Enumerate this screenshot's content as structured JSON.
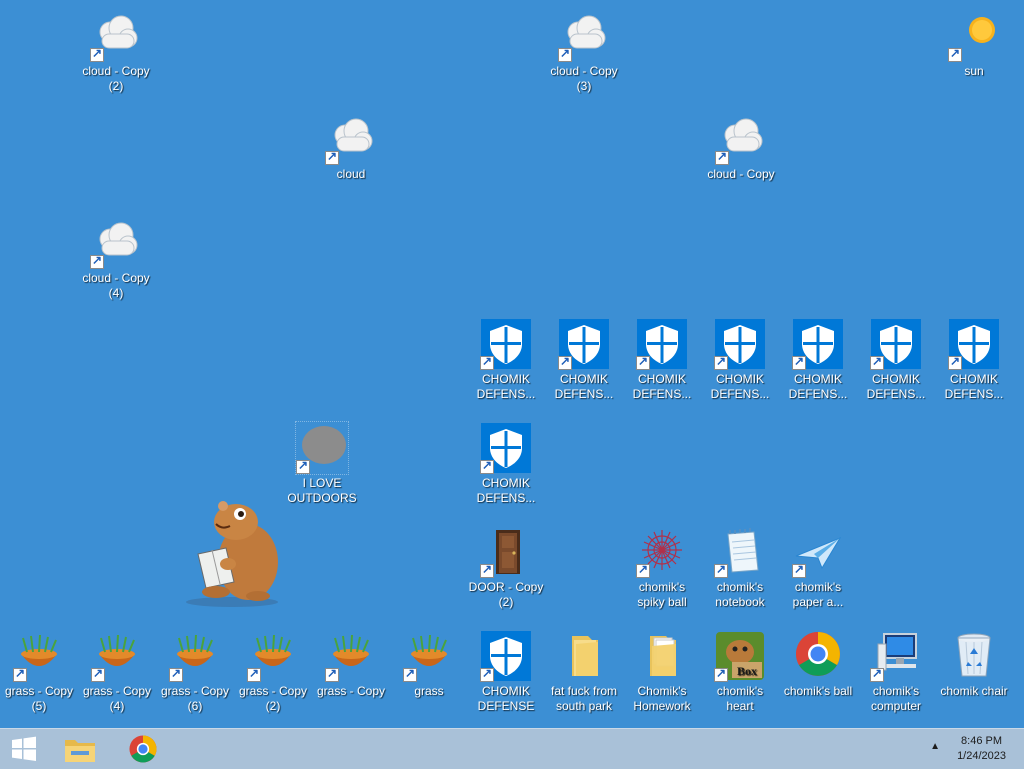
{
  "desktop": {
    "background": "#3c8fd4",
    "icons": [
      {
        "label": "cloud - Copy (2)",
        "type": "cloud"
      },
      {
        "label": "cloud - Copy (3)",
        "type": "cloud"
      },
      {
        "label": "sun",
        "type": "sun"
      },
      {
        "label": "cloud",
        "type": "cloud"
      },
      {
        "label": "cloud - Copy",
        "type": "cloud"
      },
      {
        "label": "cloud - Copy (4)",
        "type": "cloud"
      },
      {
        "label": "CHOMIK DEFENS...",
        "type": "shield"
      },
      {
        "label": "CHOMIK DEFENS...",
        "type": "shield"
      },
      {
        "label": "CHOMIK DEFENS...",
        "type": "shield"
      },
      {
        "label": "CHOMIK DEFENS...",
        "type": "shield"
      },
      {
        "label": "CHOMIK DEFENS...",
        "type": "shield"
      },
      {
        "label": "CHOMIK DEFENS...",
        "type": "shield"
      },
      {
        "label": "CHOMIK DEFENS...",
        "type": "shield"
      },
      {
        "label": "I LOVE OUTDOORS",
        "type": "blob"
      },
      {
        "label": "CHOMIK DEFENS...",
        "type": "shield"
      },
      {
        "label": "DOOR - Copy (2)",
        "type": "door"
      },
      {
        "label": "chomik's spiky ball",
        "type": "spiky"
      },
      {
        "label": "chomik's notebook",
        "type": "notebook"
      },
      {
        "label": "chomik's paper a...",
        "type": "plane"
      },
      {
        "label": "grass - Copy (5)",
        "type": "grass"
      },
      {
        "label": "grass - Copy (4)",
        "type": "grass"
      },
      {
        "label": "grass - Copy (6)",
        "type": "grass"
      },
      {
        "label": "grass - Copy (2)",
        "type": "grass"
      },
      {
        "label": "grass - Copy",
        "type": "grass"
      },
      {
        "label": "grass",
        "type": "grass"
      },
      {
        "label": "CHOMIK DEFENSE",
        "type": "shield"
      },
      {
        "label": "fat fuck from south park",
        "type": "folder"
      },
      {
        "label": "Chomik's Homework",
        "type": "folder-docs"
      },
      {
        "label": "chomik's heart",
        "type": "hamsterbox"
      },
      {
        "label": "chomik's ball",
        "type": "chrome"
      },
      {
        "label": "chomik's computer",
        "type": "computer"
      },
      {
        "label": "chomik chair",
        "type": "recycle"
      }
    ]
  },
  "taskbar": {
    "background": "#a9c1d8",
    "buttons": [
      {
        "name": "start-button",
        "icon": "windows-logo-icon"
      },
      {
        "name": "file-explorer-taskbar-button",
        "icon": "folder-icon"
      },
      {
        "name": "chrome-taskbar-button",
        "icon": "chrome-icon"
      }
    ],
    "tray_arrow": "▲",
    "time": "8:46 PM",
    "date": "1/24/2023"
  }
}
